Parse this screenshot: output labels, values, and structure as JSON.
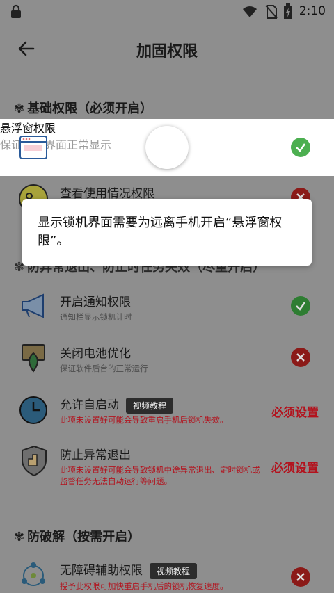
{
  "status": {
    "time": "2:10"
  },
  "header": {
    "title": "加固权限"
  },
  "sections": {
    "basic": "基础权限（必须开启）",
    "prevent": "防异常退出、防止时任务失效（尽量开启）",
    "unlock": "防破解（按需开启）"
  },
  "rows": [
    {
      "label": "悬浮窗权限",
      "sub": "保证锁机界面正常显示",
      "status": "ok"
    },
    {
      "label": "查看使用情况权限",
      "sub": "",
      "status": "bad"
    },
    {
      "label": "开启通知权限",
      "sub": "通知栏显示锁机计时",
      "status": "ok"
    },
    {
      "label": "关闭电池优化",
      "sub": "保证软件后台的正常运行",
      "status": "bad"
    },
    {
      "label": "允许自启动",
      "tag": "视频教程",
      "warn": "此项未设置好可能会导致重启手机后锁机失效。",
      "must": "必须设置"
    },
    {
      "label": "防止异常退出",
      "warn": "此项未设置好可能会导致锁机中途异常退出、定时锁机或监督任务无法自动运行等问题。",
      "must": "必须设置"
    },
    {
      "label": "无障碍辅助权限",
      "tag": "视频教程",
      "warn": "授予此权限可加快重启手机后的锁机恢复速度。",
      "status": "bad"
    }
  ],
  "toast": {
    "text": "显示锁机界面需要为远离手机开启“悬浮窗权限”。"
  },
  "colors": {
    "ok": "#2e7d32",
    "bad": "#8b1a18",
    "warn": "#b3121d"
  }
}
